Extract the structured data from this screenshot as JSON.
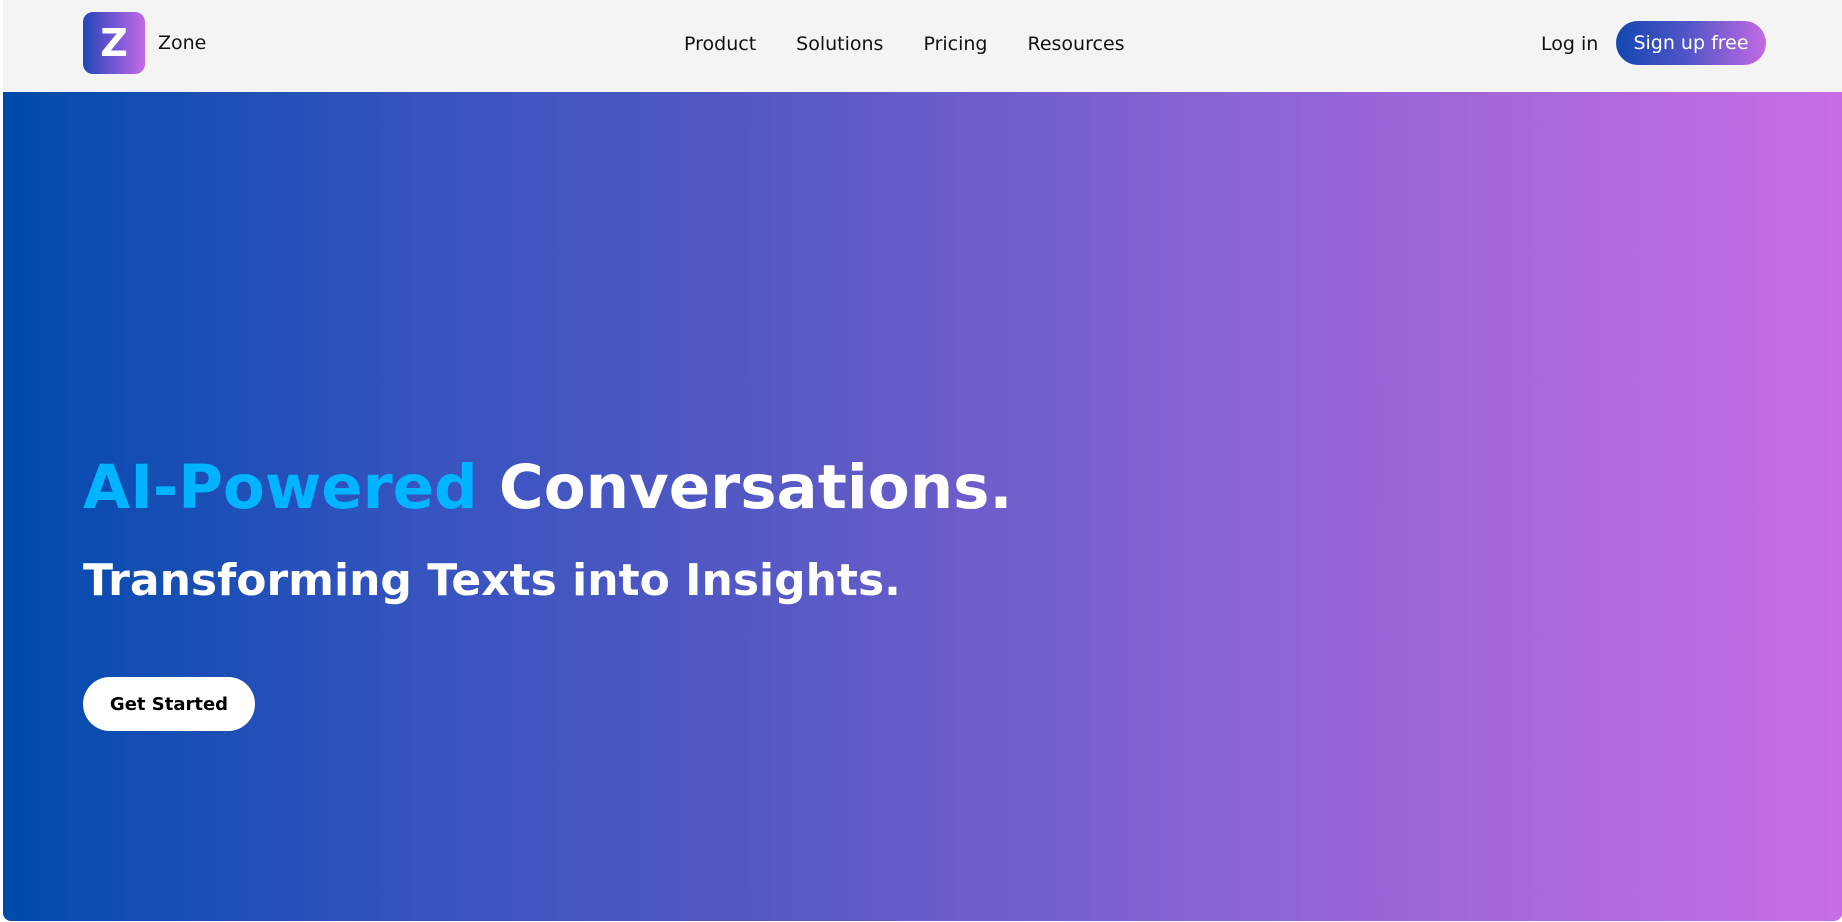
{
  "header": {
    "logo_letter": "Z",
    "brand_name": "Zone",
    "nav": [
      {
        "label": "Product"
      },
      {
        "label": "Solutions"
      },
      {
        "label": "Pricing"
      },
      {
        "label": "Resources"
      }
    ],
    "login_label": "Log in",
    "signup_label": "Sign up free"
  },
  "hero": {
    "headline_accent": "AI-Powered",
    "headline_main": " Conversations.",
    "subheadline": "Transforming Texts into Insights.",
    "cta_label": "Get Started"
  },
  "colors": {
    "hero_gradient_start": "#014aac",
    "hero_gradient_end": "#c86de7",
    "accent_text": "#00b4ff",
    "navbar_background": "#f4f4f4"
  }
}
